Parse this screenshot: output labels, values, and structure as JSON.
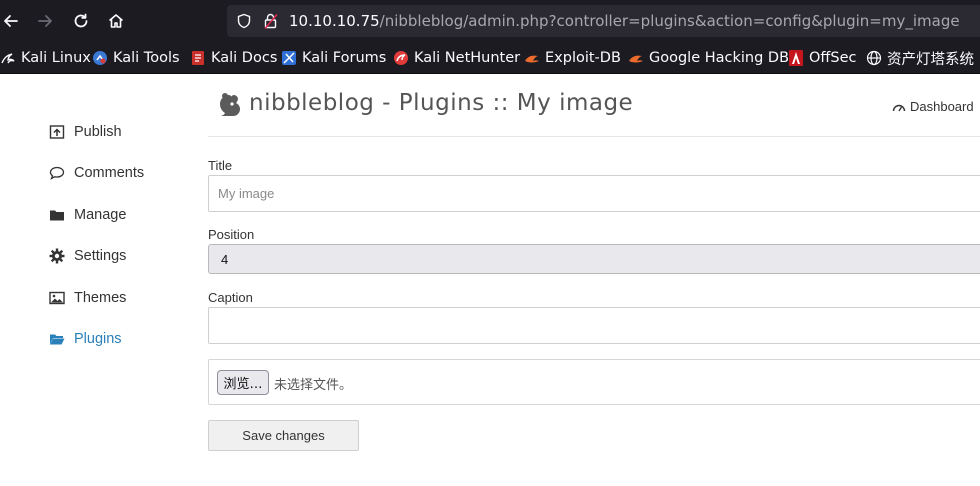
{
  "browser": {
    "url_host": "10.10.10.75",
    "url_path": "/nibbleblog/admin.php?controller=plugins&action=config&plugin=my_image",
    "bookmarks": [
      {
        "label": "Kali Linux",
        "icon": "kali-dragon-icon"
      },
      {
        "label": "Kali Tools",
        "icon": "kali-tools-icon"
      },
      {
        "label": "Kali Docs",
        "icon": "kali-docs-icon"
      },
      {
        "label": "Kali Forums",
        "icon": "kali-forums-icon"
      },
      {
        "label": "Kali NetHunter",
        "icon": "nethunter-icon"
      },
      {
        "label": "Exploit-DB",
        "icon": "exploit-db-icon"
      },
      {
        "label": "Google Hacking DB",
        "icon": "ghdb-icon"
      },
      {
        "label": "OffSec",
        "icon": "offsec-icon"
      },
      {
        "label": "资产灯塔系统",
        "icon": "globe-icon"
      }
    ]
  },
  "sidebar": {
    "items": [
      {
        "label": "Publish",
        "icon": "publish-icon",
        "active": false
      },
      {
        "label": "Comments",
        "icon": "comment-icon",
        "active": false
      },
      {
        "label": "Manage",
        "icon": "folder-icon",
        "active": false
      },
      {
        "label": "Settings",
        "icon": "gear-icon",
        "active": false
      },
      {
        "label": "Themes",
        "icon": "image-icon",
        "active": false
      },
      {
        "label": "Plugins",
        "icon": "folder-open-icon",
        "active": true
      }
    ]
  },
  "header": {
    "title": "nibbleblog - Plugins :: My image",
    "dashboard_label": "Dashboard"
  },
  "form": {
    "title_label": "Title",
    "title_placeholder": "My image",
    "position_label": "Position",
    "position_value": "4",
    "caption_label": "Caption",
    "caption_value": "",
    "browse_label": "浏览…",
    "file_status": "未选择文件。",
    "save_label": "Save changes"
  },
  "colors": {
    "accent": "#2a80b9",
    "chrome_bg": "#1c1b22",
    "urlbar_bg": "#2b2a33"
  }
}
